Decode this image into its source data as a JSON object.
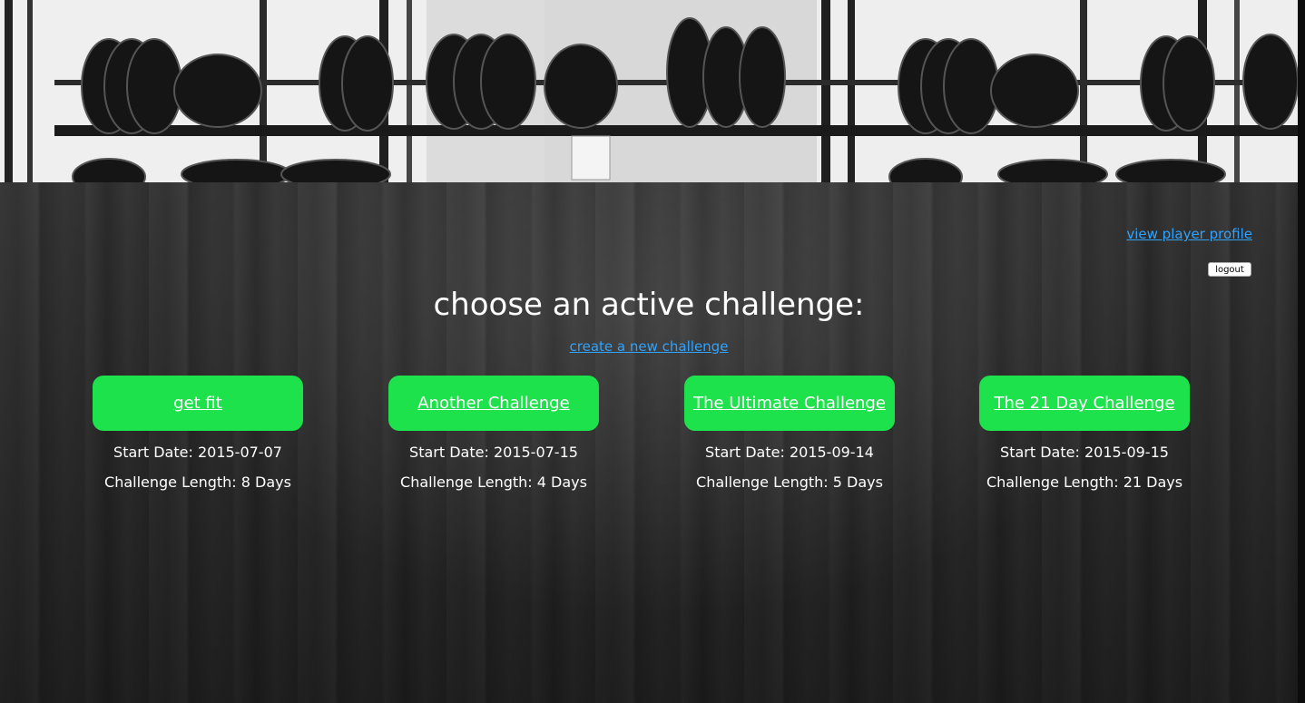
{
  "header": {
    "profile_link": "view player profile",
    "logout_label": "logout"
  },
  "main": {
    "heading": "choose an active challenge:",
    "create_link": "create a new challenge",
    "challenges": [
      {
        "title": "get fit",
        "start_label": "Start Date:",
        "start_date": "2015-07-07",
        "length_label": "Challenge Length:",
        "length": "8 Days"
      },
      {
        "title": "Another Challenge",
        "start_label": "Start Date:",
        "start_date": "2015-07-15",
        "length_label": "Challenge Length:",
        "length": "4 Days"
      },
      {
        "title": "The Ultimate Challenge",
        "start_label": "Start Date:",
        "start_date": "2015-09-14",
        "length_label": "Challenge Length:",
        "length": "5 Days"
      },
      {
        "title": "The 21 Day Challenge",
        "start_label": "Start Date:",
        "start_date": "2015-09-15",
        "length_label": "Challenge Length:",
        "length": "21 Days"
      }
    ]
  },
  "colors": {
    "accent_green": "#1de24b",
    "link_blue": "#2fa3ff"
  }
}
